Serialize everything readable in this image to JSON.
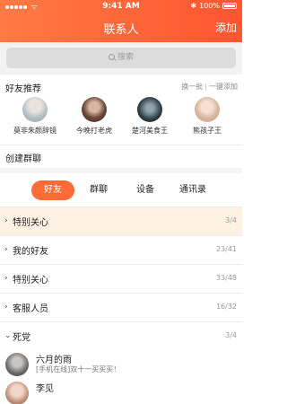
{
  "status_bar": {
    "time": "9:41 AM",
    "battery": "100%"
  },
  "header": {
    "title": "联系人",
    "add_label": "添加"
  },
  "search": {
    "placeholder": "搜索"
  },
  "recommend": {
    "label": "好友推荐",
    "swap_label": "换一批",
    "add_all_label": "一键添加",
    "friends": [
      {
        "name": "莫非朱颜辞镜"
      },
      {
        "name": "今晚打老虎"
      },
      {
        "name": "楚河美食王"
      },
      {
        "name": "熊孩子王"
      }
    ]
  },
  "create_group": {
    "label": "创建群聊"
  },
  "tabs": [
    {
      "label": "好友"
    },
    {
      "label": "群聊"
    },
    {
      "label": "设备"
    },
    {
      "label": "通讯录"
    }
  ],
  "groups": [
    {
      "name": "特别关心",
      "count": "3/4"
    },
    {
      "name": "我的好友",
      "count": "23/41"
    },
    {
      "name": "特别关心",
      "count": "33/48"
    },
    {
      "name": "客服人员",
      "count": "16/32"
    },
    {
      "name": "死党",
      "count": "3/4"
    }
  ],
  "contacts": [
    {
      "name": "六月的雨",
      "status": "[手机在线]双十一买买买！"
    },
    {
      "name": "李见",
      "status": ""
    }
  ],
  "colors": {
    "accent": "#ff6a35",
    "header_start": "#ff7a45",
    "header_end": "#ff5530",
    "highlight_row": "#fdf1e3"
  }
}
